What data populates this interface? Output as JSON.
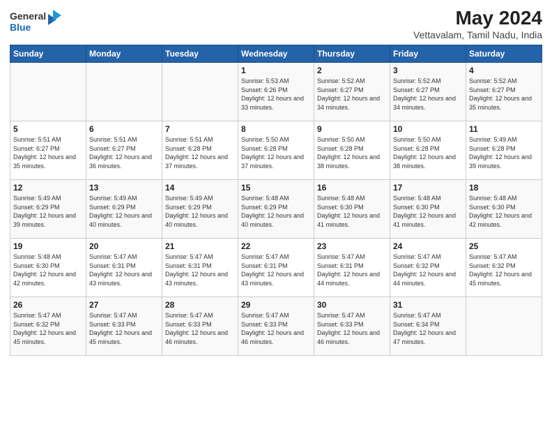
{
  "logo": {
    "general": "General",
    "blue": "Blue"
  },
  "title": "May 2024",
  "subtitle": "Vettavalam, Tamil Nadu, India",
  "days_of_week": [
    "Sunday",
    "Monday",
    "Tuesday",
    "Wednesday",
    "Thursday",
    "Friday",
    "Saturday"
  ],
  "weeks": [
    [
      {
        "day": "",
        "info": ""
      },
      {
        "day": "",
        "info": ""
      },
      {
        "day": "",
        "info": ""
      },
      {
        "day": "1",
        "info": "Sunrise: 5:53 AM\nSunset: 6:26 PM\nDaylight: 12 hours and 33 minutes."
      },
      {
        "day": "2",
        "info": "Sunrise: 5:52 AM\nSunset: 6:27 PM\nDaylight: 12 hours and 34 minutes."
      },
      {
        "day": "3",
        "info": "Sunrise: 5:52 AM\nSunset: 6:27 PM\nDaylight: 12 hours and 34 minutes."
      },
      {
        "day": "4",
        "info": "Sunrise: 5:52 AM\nSunset: 6:27 PM\nDaylight: 12 hours and 35 minutes."
      }
    ],
    [
      {
        "day": "5",
        "info": "Sunrise: 5:51 AM\nSunset: 6:27 PM\nDaylight: 12 hours and 35 minutes."
      },
      {
        "day": "6",
        "info": "Sunrise: 5:51 AM\nSunset: 6:27 PM\nDaylight: 12 hours and 36 minutes."
      },
      {
        "day": "7",
        "info": "Sunrise: 5:51 AM\nSunset: 6:28 PM\nDaylight: 12 hours and 37 minutes."
      },
      {
        "day": "8",
        "info": "Sunrise: 5:50 AM\nSunset: 6:28 PM\nDaylight: 12 hours and 37 minutes."
      },
      {
        "day": "9",
        "info": "Sunrise: 5:50 AM\nSunset: 6:28 PM\nDaylight: 12 hours and 38 minutes."
      },
      {
        "day": "10",
        "info": "Sunrise: 5:50 AM\nSunset: 6:28 PM\nDaylight: 12 hours and 38 minutes."
      },
      {
        "day": "11",
        "info": "Sunrise: 5:49 AM\nSunset: 6:28 PM\nDaylight: 12 hours and 39 minutes."
      }
    ],
    [
      {
        "day": "12",
        "info": "Sunrise: 5:49 AM\nSunset: 6:29 PM\nDaylight: 12 hours and 39 minutes."
      },
      {
        "day": "13",
        "info": "Sunrise: 5:49 AM\nSunset: 6:29 PM\nDaylight: 12 hours and 40 minutes."
      },
      {
        "day": "14",
        "info": "Sunrise: 5:49 AM\nSunset: 6:29 PM\nDaylight: 12 hours and 40 minutes."
      },
      {
        "day": "15",
        "info": "Sunrise: 5:48 AM\nSunset: 6:29 PM\nDaylight: 12 hours and 40 minutes."
      },
      {
        "day": "16",
        "info": "Sunrise: 5:48 AM\nSunset: 6:30 PM\nDaylight: 12 hours and 41 minutes."
      },
      {
        "day": "17",
        "info": "Sunrise: 5:48 AM\nSunset: 6:30 PM\nDaylight: 12 hours and 41 minutes."
      },
      {
        "day": "18",
        "info": "Sunrise: 5:48 AM\nSunset: 6:30 PM\nDaylight: 12 hours and 42 minutes."
      }
    ],
    [
      {
        "day": "19",
        "info": "Sunrise: 5:48 AM\nSunset: 6:30 PM\nDaylight: 12 hours and 42 minutes."
      },
      {
        "day": "20",
        "info": "Sunrise: 5:47 AM\nSunset: 6:31 PM\nDaylight: 12 hours and 43 minutes."
      },
      {
        "day": "21",
        "info": "Sunrise: 5:47 AM\nSunset: 6:31 PM\nDaylight: 12 hours and 43 minutes."
      },
      {
        "day": "22",
        "info": "Sunrise: 5:47 AM\nSunset: 6:31 PM\nDaylight: 12 hours and 43 minutes."
      },
      {
        "day": "23",
        "info": "Sunrise: 5:47 AM\nSunset: 6:31 PM\nDaylight: 12 hours and 44 minutes."
      },
      {
        "day": "24",
        "info": "Sunrise: 5:47 AM\nSunset: 6:32 PM\nDaylight: 12 hours and 44 minutes."
      },
      {
        "day": "25",
        "info": "Sunrise: 5:47 AM\nSunset: 6:32 PM\nDaylight: 12 hours and 45 minutes."
      }
    ],
    [
      {
        "day": "26",
        "info": "Sunrise: 5:47 AM\nSunset: 6:32 PM\nDaylight: 12 hours and 45 minutes."
      },
      {
        "day": "27",
        "info": "Sunrise: 5:47 AM\nSunset: 6:33 PM\nDaylight: 12 hours and 45 minutes."
      },
      {
        "day": "28",
        "info": "Sunrise: 5:47 AM\nSunset: 6:33 PM\nDaylight: 12 hours and 46 minutes."
      },
      {
        "day": "29",
        "info": "Sunrise: 5:47 AM\nSunset: 6:33 PM\nDaylight: 12 hours and 46 minutes."
      },
      {
        "day": "30",
        "info": "Sunrise: 5:47 AM\nSunset: 6:33 PM\nDaylight: 12 hours and 46 minutes."
      },
      {
        "day": "31",
        "info": "Sunrise: 5:47 AM\nSunset: 6:34 PM\nDaylight: 12 hours and 47 minutes."
      },
      {
        "day": "",
        "info": ""
      }
    ]
  ]
}
